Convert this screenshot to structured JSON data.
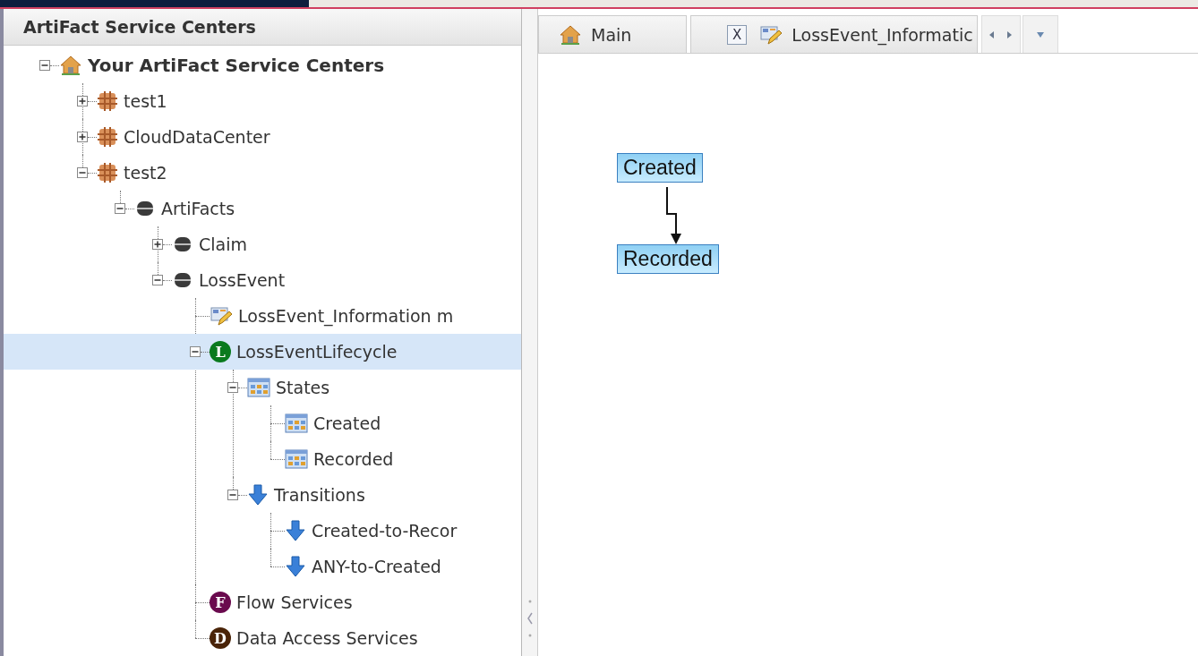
{
  "panel": {
    "title": "ArtiFact Service Centers"
  },
  "tree": [
    {
      "label": "Your ArtiFact Service Centers",
      "kind": "home",
      "selected": false,
      "expanded": true,
      "children": [
        {
          "label": "test1",
          "kind": "grid",
          "selected": false,
          "expanded": false
        },
        {
          "label": "CloudDataCenter",
          "kind": "grid",
          "selected": false,
          "expanded": false
        },
        {
          "label": "test2",
          "kind": "grid",
          "selected": false,
          "expanded": true,
          "children": [
            {
              "label": "ArtiFacts",
              "kind": "disk",
              "selected": false,
              "expanded": true,
              "children": [
                {
                  "label": "Claim",
                  "kind": "disk",
                  "selected": false,
                  "expanded": false
                },
                {
                  "label": "LossEvent",
                  "kind": "disk",
                  "selected": false,
                  "expanded": true,
                  "children": [
                    {
                      "label": "LossEvent_Information m",
                      "kind": "document",
                      "selected": false
                    },
                    {
                      "label": "LossEventLifecycle",
                      "kind": "letter",
                      "badge": "L",
                      "color": "#0a7a1e",
                      "selected": true,
                      "expanded": true,
                      "children": [
                        {
                          "label": "States",
                          "kind": "table",
                          "selected": false,
                          "expanded": true,
                          "children": [
                            {
                              "label": "Created",
                              "kind": "table",
                              "selected": false
                            },
                            {
                              "label": "Recorded",
                              "kind": "table",
                              "selected": false
                            }
                          ]
                        },
                        {
                          "label": "Transitions",
                          "kind": "arrow",
                          "selected": false,
                          "expanded": true,
                          "children": [
                            {
                              "label": "Created-to-Recor",
                              "kind": "arrow",
                              "selected": false
                            },
                            {
                              "label": "ANY-to-Created",
                              "kind": "arrow",
                              "selected": false
                            }
                          ]
                        }
                      ]
                    },
                    {
                      "label": "Flow Services",
                      "kind": "letter",
                      "badge": "F",
                      "color": "#6a0a4e",
                      "selected": false
                    },
                    {
                      "label": "Data Access Services",
                      "kind": "letter",
                      "badge": "D",
                      "color": "#4a2408",
                      "selected": false
                    }
                  ]
                }
              ]
            }
          ]
        }
      ]
    }
  ],
  "tabs": [
    {
      "label": "Main",
      "kind": "home"
    },
    {
      "label": "LossEvent_Informatic",
      "kind": "document",
      "close": "X"
    }
  ],
  "diagram": {
    "states": [
      {
        "label": "Created"
      },
      {
        "label": "Recorded"
      }
    ]
  }
}
